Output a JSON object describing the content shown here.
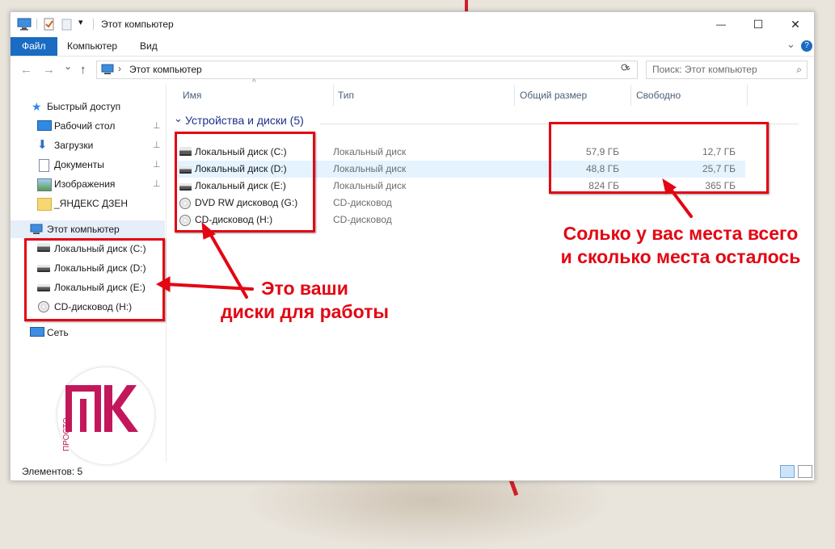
{
  "window": {
    "title": "Этот компьютер",
    "minimize": "—",
    "maximize": "☐",
    "close": "✕"
  },
  "ribbon": {
    "tabs": [
      {
        "label": "Файл"
      },
      {
        "label": "Компьютер"
      },
      {
        "label": "Вид"
      }
    ],
    "expand": "⌄",
    "help": "?"
  },
  "address": {
    "back": "←",
    "forward": "→",
    "recent": "⌄",
    "up": "↑",
    "path": "Этот компьютер",
    "separator": "›",
    "dropdown": "⌄",
    "refresh": "⟳",
    "search_placeholder": "Поиск: Этот компьютер",
    "search_icon": "⌕"
  },
  "nav": {
    "quick_access": "Быстрый доступ",
    "quick_items": [
      {
        "label": "Рабочий стол",
        "icon": "desktop-icon"
      },
      {
        "label": "Загрузки",
        "icon": "download-icon"
      },
      {
        "label": "Документы",
        "icon": "documents-icon"
      },
      {
        "label": "Изображения",
        "icon": "pictures-icon"
      },
      {
        "label": "_ЯНДЕКС ДЗЕН",
        "icon": "folder-icon"
      }
    ],
    "pin": "📌",
    "this_pc": "Этот компьютер",
    "drives": [
      {
        "label": "Локальный диск (C:)"
      },
      {
        "label": "Локальный диск (D:)"
      },
      {
        "label": "Локальный диск (E:)"
      },
      {
        "label": "CD-дисковод (H:)"
      }
    ],
    "network": "Сеть"
  },
  "columns": {
    "name": "Имя",
    "type": "Тип",
    "total": "Общий размер",
    "free": "Свободно",
    "sort_indicator": "^"
  },
  "group": {
    "label": "Устройства и диски (5)",
    "chevron": "⌄"
  },
  "drives": [
    {
      "name": "Локальный диск (C:)",
      "type": "Локальный диск",
      "total": "57,9 ГБ",
      "free": "12,7 ГБ"
    },
    {
      "name": "Локальный диск (D:)",
      "type": "Локальный диск",
      "total": "48,8 ГБ",
      "free": "25,7 ГБ"
    },
    {
      "name": "Локальный диск (E:)",
      "type": "Локальный диск",
      "total": "824 ГБ",
      "free": "365 ГБ"
    },
    {
      "name": "DVD RW дисковод (G:)",
      "type": "CD-дисковод",
      "total": "",
      "free": ""
    },
    {
      "name": "CD-дисковод (H:)",
      "type": "CD-дисковод",
      "total": "",
      "free": ""
    }
  ],
  "status": {
    "count": "Элементов: 5"
  },
  "annotations": {
    "disks_line1": "Это ваши",
    "disks_line2": "диски для работы",
    "space_line1": "Солько у вас места всего",
    "space_line2": "и сколько места осталось"
  },
  "logo": {
    "big": "ПК",
    "small": "ПРОСТО"
  },
  "colors": {
    "accent": "#1a6bc2",
    "annotation": "#e30613",
    "group_heading": "#1e3287"
  }
}
